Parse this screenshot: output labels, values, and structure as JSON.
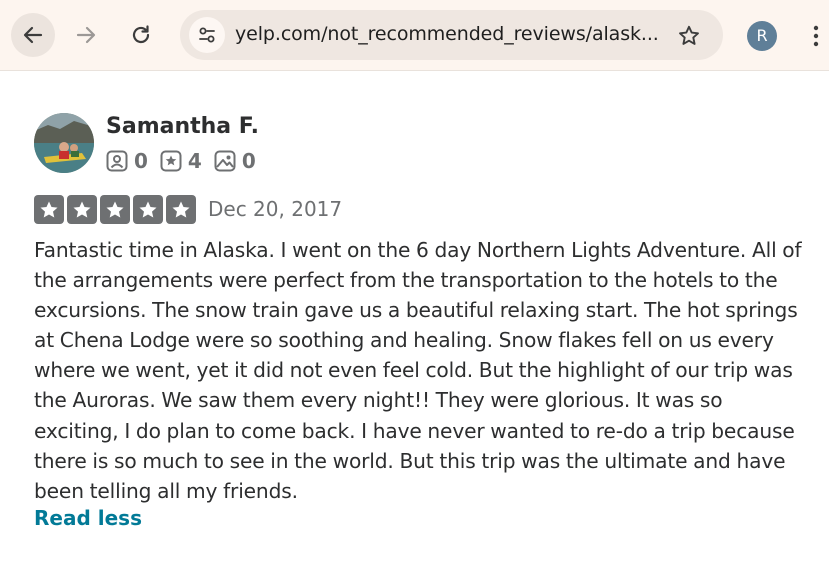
{
  "browser": {
    "url": "yelp.com/not_recommended_reviews/alask...",
    "profile_initial": "R",
    "icons": [
      "back-arrow-icon",
      "forward-arrow-icon",
      "reload-icon",
      "site-info-icon",
      "bookmark-star-icon",
      "kebab-menu-icon"
    ]
  },
  "review": {
    "user_name": "Samantha F.",
    "friends_count": "0",
    "reviews_count": "4",
    "photos_count": "0",
    "rating": 5,
    "date": "Dec 20, 2017",
    "text": "Fantastic time in Alaska. I went on the 6 day Northern Lights Adventure. All of the arrangements were perfect from the transportation to the hotels to the excursions. The snow train gave us a beautiful relaxing start. The hot springs at Chena Lodge were so soothing and healing. Snow flakes fell on us every where we went, yet it did not even feel cold. But the highlight of our trip was the Auroras. We saw them every night!! They were glorious. It was so exciting, I do plan to come back. I have never wanted to re-do a trip because there is so much to see in the world. But this trip was the ultimate and have been telling all my friends.",
    "read_less_label": "Read less"
  },
  "colors": {
    "toolbar_bg": "#fdf5ef",
    "star_box": "#6e7072",
    "link": "#027a97",
    "profile": "#5f7f98"
  }
}
